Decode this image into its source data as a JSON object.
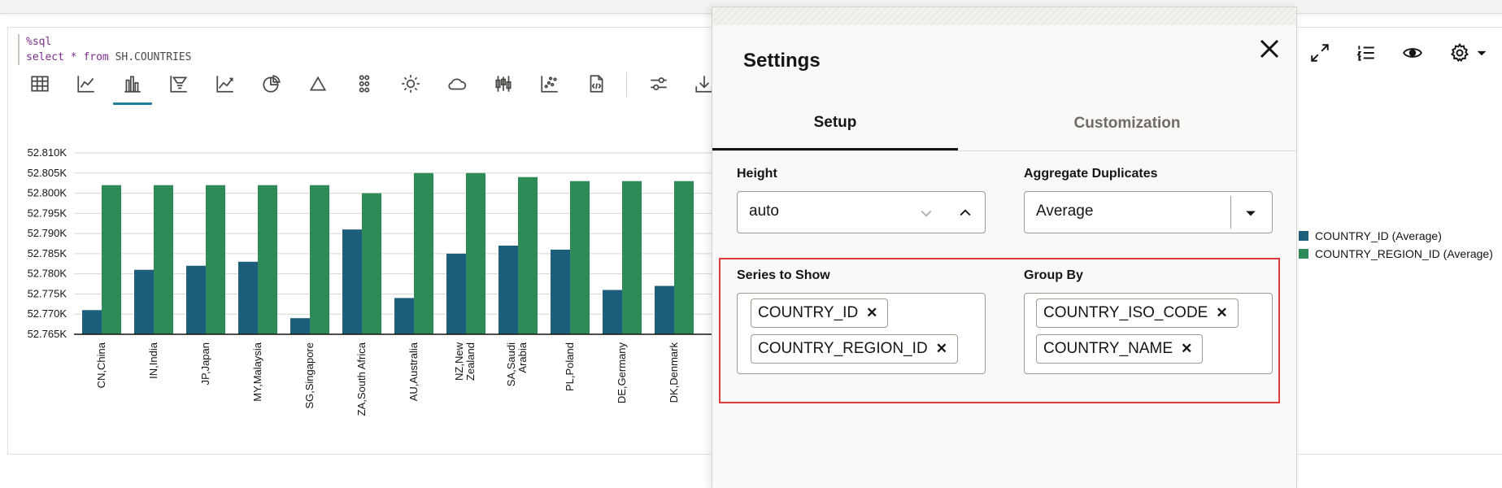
{
  "code": {
    "magic": "%sql",
    "query_keyword": "select * from",
    "query_table": "SH.COUNTRIES"
  },
  "toolbar": {
    "icons": [
      "table-icon",
      "line-chart-icon",
      "bar-chart-icon",
      "funnel-chart-icon",
      "area-chart-icon",
      "pie-chart-icon",
      "pyramid-icon",
      "scatter-dots-icon",
      "sunburst-icon",
      "cloud-icon",
      "boxplot-icon",
      "scatter-chart-icon",
      "code-file-icon",
      "settings-sliders-icon",
      "download-icon"
    ],
    "active": "bar-chart-icon"
  },
  "right_toolbar": {
    "icons": [
      "expand-icon",
      "list-numbered-icon",
      "eye-icon",
      "gear-icon",
      "chevron-down-icon"
    ]
  },
  "chart_data": {
    "type": "bar",
    "categories": [
      "CN,China",
      "IN,India",
      "JP,Japan",
      "MY,Malaysia",
      "SG,Singapore",
      "ZA,South Africa",
      "AU,Australia",
      "NZ,New Zealand",
      "SA,Saudi Arabia",
      "PL,Poland",
      "DE,Germany",
      "DK,Denmark"
    ],
    "category_lines": [
      [
        "CN,China"
      ],
      [
        "IN,India"
      ],
      [
        "JP,Japan"
      ],
      [
        "MY,Malaysia"
      ],
      [
        "SG,Singapore"
      ],
      [
        "ZA,South Africa"
      ],
      [
        "AU,Australia"
      ],
      [
        "NZ,New",
        "Zealand"
      ],
      [
        "SA,Saudi",
        "Arabia"
      ],
      [
        "PL,Poland"
      ],
      [
        "DE,Germany"
      ],
      [
        "DK,Denmark"
      ]
    ],
    "series": [
      {
        "name": "COUNTRY_ID (Average)",
        "color": "#1d5f7a",
        "values": [
          52771,
          52781,
          52782,
          52783,
          52769,
          52791,
          52774,
          52785,
          52787,
          52786,
          52776,
          52777
        ]
      },
      {
        "name": "COUNTRY_REGION_ID (Average)",
        "color": "#2e8b57",
        "values": [
          52802,
          52802,
          52802,
          52802,
          52802,
          52800,
          52805,
          52805,
          52804,
          52803,
          52803,
          52803
        ]
      }
    ],
    "ylim": [
      52765,
      52810
    ],
    "yticks": [
      "52.765K",
      "52.770K",
      "52.775K",
      "52.780K",
      "52.785K",
      "52.790K",
      "52.795K",
      "52.800K",
      "52.805K",
      "52.810K"
    ],
    "grid": true,
    "legend_position": "right"
  },
  "settings": {
    "title": "Settings",
    "tabs": [
      "Setup",
      "Customization"
    ],
    "active_tab": "Setup",
    "height_label": "Height",
    "height_value": "auto",
    "aggregate_label": "Aggregate Duplicates",
    "aggregate_value": "Average",
    "series_label": "Series to Show",
    "series_chips": [
      "COUNTRY_ID",
      "COUNTRY_REGION_ID"
    ],
    "groupby_label": "Group By",
    "groupby_chips": [
      "COUNTRY_ISO_CODE",
      "COUNTRY_NAME"
    ],
    "highlight_color": "#e03b3b"
  }
}
